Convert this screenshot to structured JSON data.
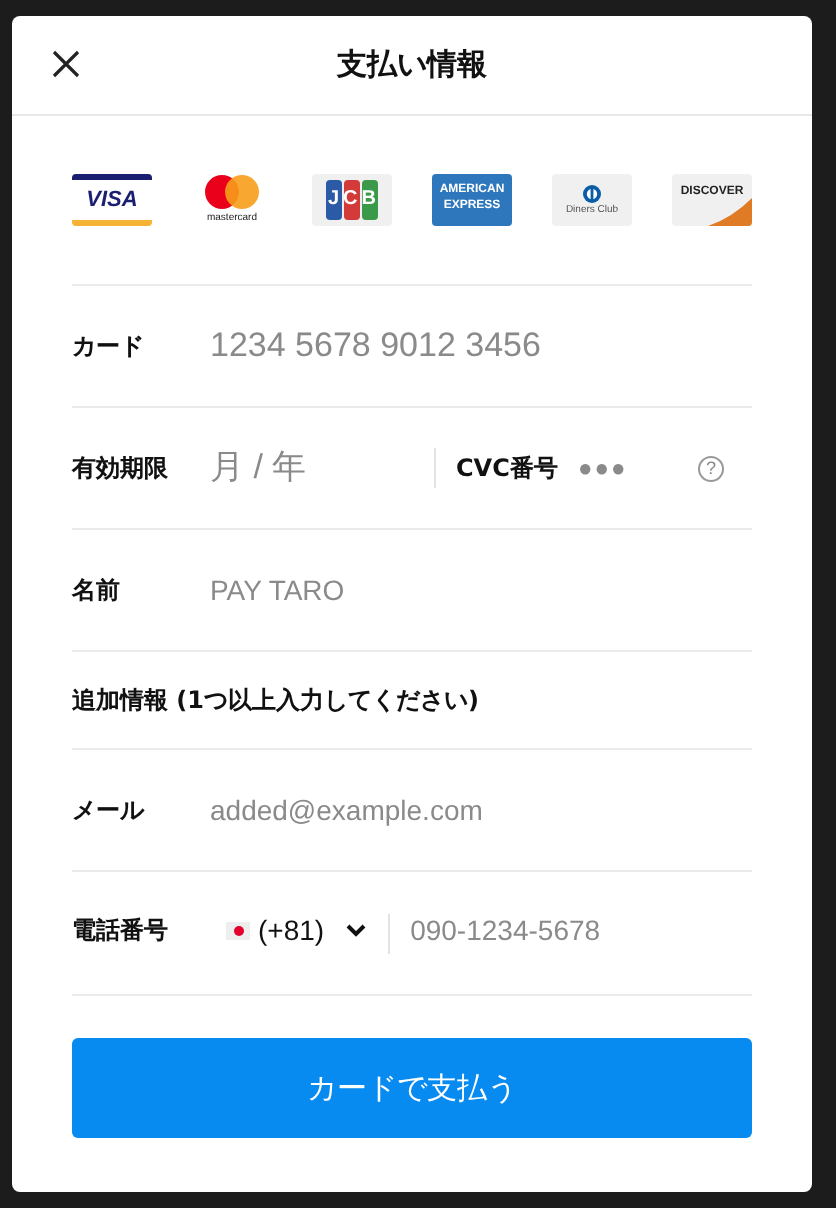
{
  "dialog": {
    "title": "支払い情報"
  },
  "card_brands": [
    {
      "kind": "visa",
      "label": "VISA"
    },
    {
      "kind": "mastercard",
      "label": "mastercard"
    },
    {
      "kind": "jcb",
      "label": "JCB"
    },
    {
      "kind": "amex",
      "label": "AMERICAN EXPRESS"
    },
    {
      "kind": "diners",
      "label": "Diners Club"
    },
    {
      "kind": "discover",
      "label": "DISCOVER"
    }
  ],
  "card": {
    "label": "カード",
    "placeholder": "1234 5678 9012 3456"
  },
  "expiry": {
    "label": "有効期限",
    "placeholder": "月 / 年"
  },
  "cvc": {
    "label": "CVC番号",
    "placeholder": "●●●",
    "help_icon": "?"
  },
  "name": {
    "label": "名前",
    "placeholder": "PAY TARO"
  },
  "additional_heading": "追加情報 (1つ以上入力してください)",
  "email": {
    "label": "メール",
    "placeholder": "added@example.com"
  },
  "phone": {
    "label": "電話番号",
    "country_code": "(+81)",
    "placeholder": "090-1234-5678"
  },
  "submit_button": "カードで支払う"
}
